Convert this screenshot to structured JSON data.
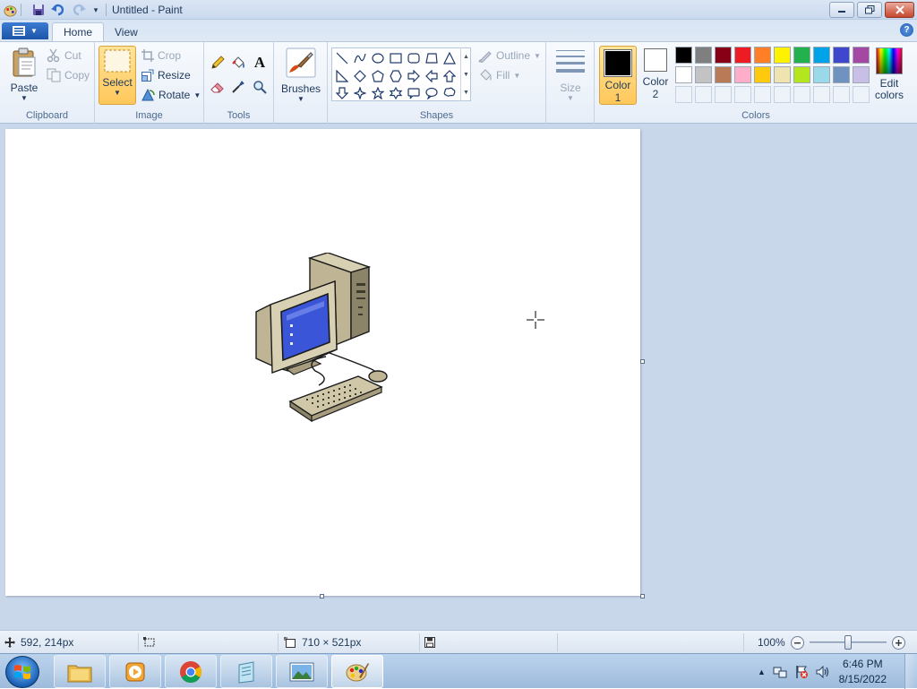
{
  "window": {
    "title": "Untitled - Paint"
  },
  "tabs": {
    "home": "Home",
    "view": "View"
  },
  "clipboard": {
    "paste": "Paste",
    "cut": "Cut",
    "copy": "Copy",
    "group_label": "Clipboard"
  },
  "image": {
    "select": "Select",
    "crop": "Crop",
    "resize": "Resize",
    "rotate": "Rotate",
    "group_label": "Image"
  },
  "tools": {
    "group_label": "Tools",
    "items": [
      "pencil-icon",
      "fill-icon",
      "text-icon",
      "eraser-icon",
      "color-picker-icon",
      "magnifier-icon"
    ]
  },
  "brushes": {
    "label": "Brushes"
  },
  "shapes": {
    "group_label": "Shapes",
    "outline": "Outline",
    "fill": "Fill",
    "size": "Size"
  },
  "colors": {
    "color1_label": "Color",
    "color1_num": "1",
    "color2_label": "Color",
    "color2_num": "2",
    "color1_value": "#000000",
    "color2_value": "#ffffff",
    "edit_line1": "Edit",
    "edit_line2": "colors",
    "group_label": "Colors",
    "palette_row1": [
      "#000000",
      "#7f7f7f",
      "#880015",
      "#ed1c24",
      "#ff7f27",
      "#fff200",
      "#22b14c",
      "#00a2e8",
      "#3f48cc",
      "#a349a4"
    ],
    "palette_row2": [
      "#ffffff",
      "#c3c3c3",
      "#b97a57",
      "#ffaec9",
      "#ffc90e",
      "#efe4b0",
      "#b5e61d",
      "#99d9ea",
      "#7092be",
      "#c8bfe7"
    ]
  },
  "statusbar": {
    "cursor_pos": "592, 214px",
    "image_size": "710 × 521px",
    "zoom": "100%",
    "zoom_level": 0.5
  },
  "taskbar": {
    "time": "6:46 PM",
    "date": "8/15/2022"
  }
}
